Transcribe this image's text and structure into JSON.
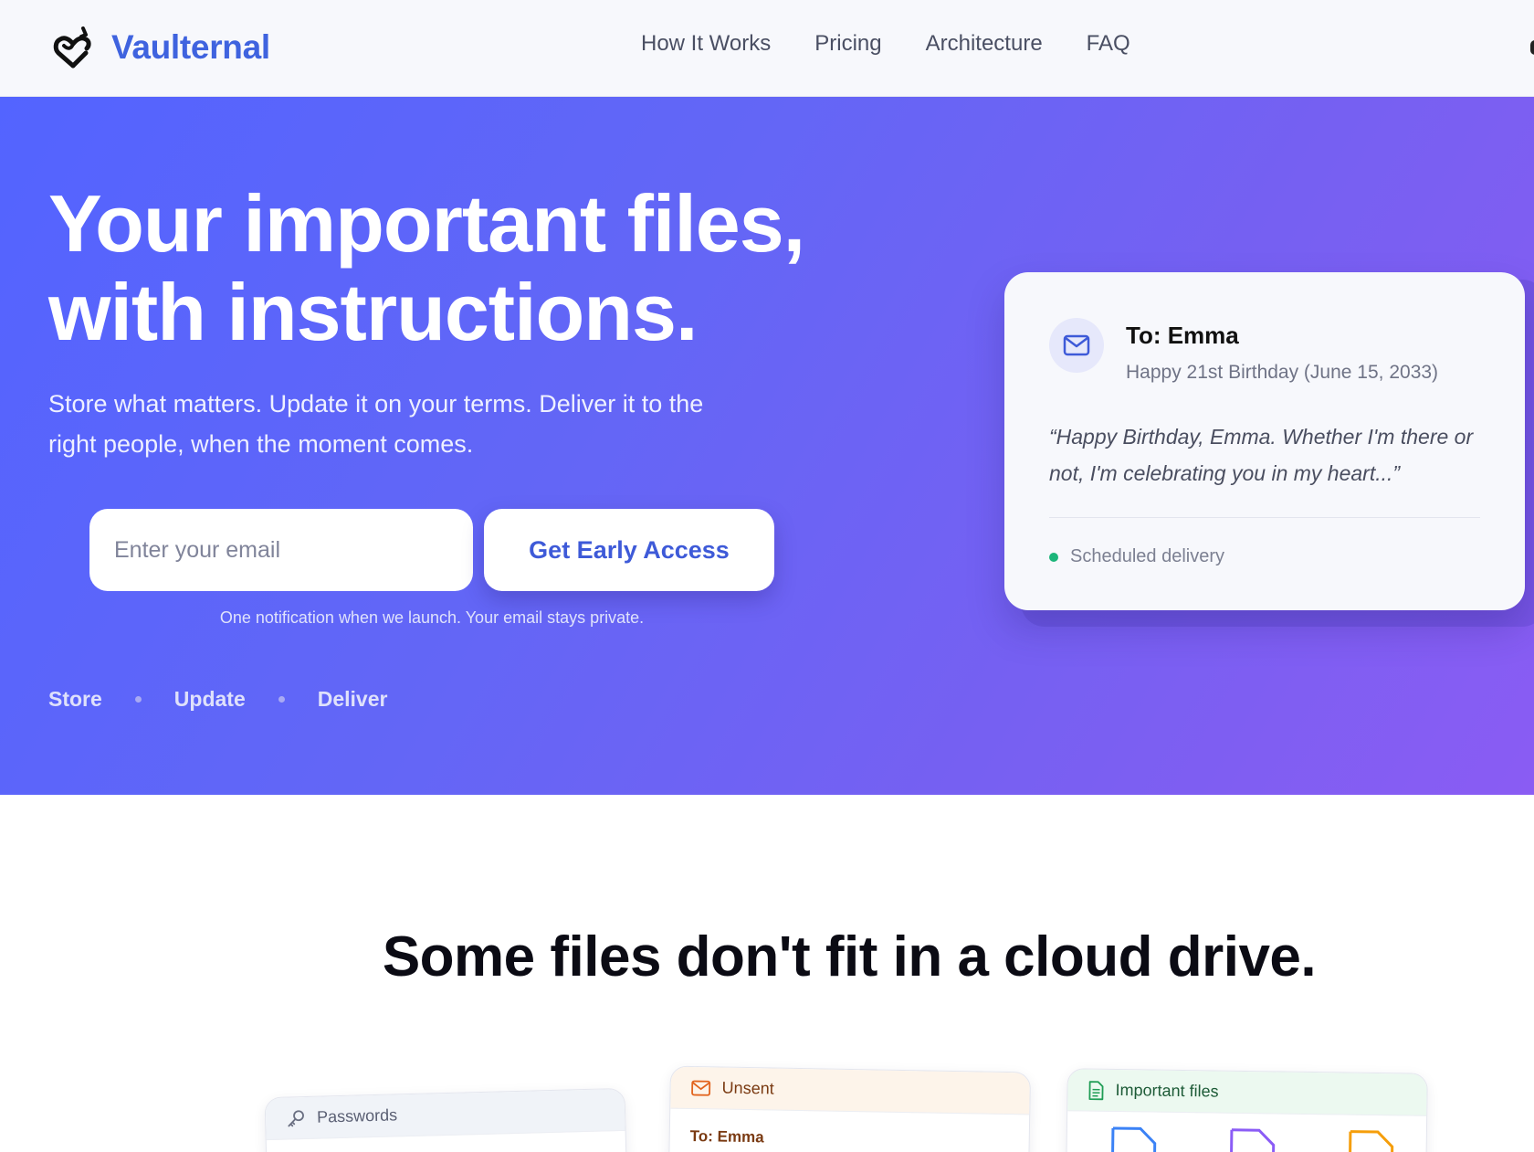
{
  "header": {
    "brand": "Vaulternal",
    "nav": [
      "How It Works",
      "Pricing",
      "Architecture",
      "FAQ"
    ]
  },
  "hero": {
    "title_line1": "Your important files,",
    "title_line2": "with instructions.",
    "subtitle": "Store what matters. Update it on your terms. Deliver it to the right people, when the moment comes.",
    "email_placeholder": "Enter your email",
    "cta_label": "Get Early Access",
    "notice": "One notification when we launch. Your email stays private.",
    "steps": [
      "Store",
      "Update",
      "Deliver"
    ]
  },
  "preview_card": {
    "icon": "mail-icon",
    "to": "To: Emma",
    "occasion": "Happy 21st Birthday (June 15, 2033)",
    "quote": "“Happy Birthday, Emma. Whether I'm there or not, I'm celebrating you in my heart...”",
    "status": "Scheduled delivery",
    "status_color": "#1cb57a"
  },
  "section2": {
    "title": "Some files don't fit in a cloud drive.",
    "cards": [
      {
        "icon": "key-icon",
        "label": "Passwords"
      },
      {
        "icon": "mail-icon",
        "label": "Unsent",
        "preview_to": "To: Emma"
      },
      {
        "icon": "document-icon",
        "label": "Important files"
      }
    ]
  },
  "colors": {
    "brand": "#3f63df",
    "hero_gradient_start": "#5364ff",
    "hero_gradient_end": "#8a5cf3"
  }
}
